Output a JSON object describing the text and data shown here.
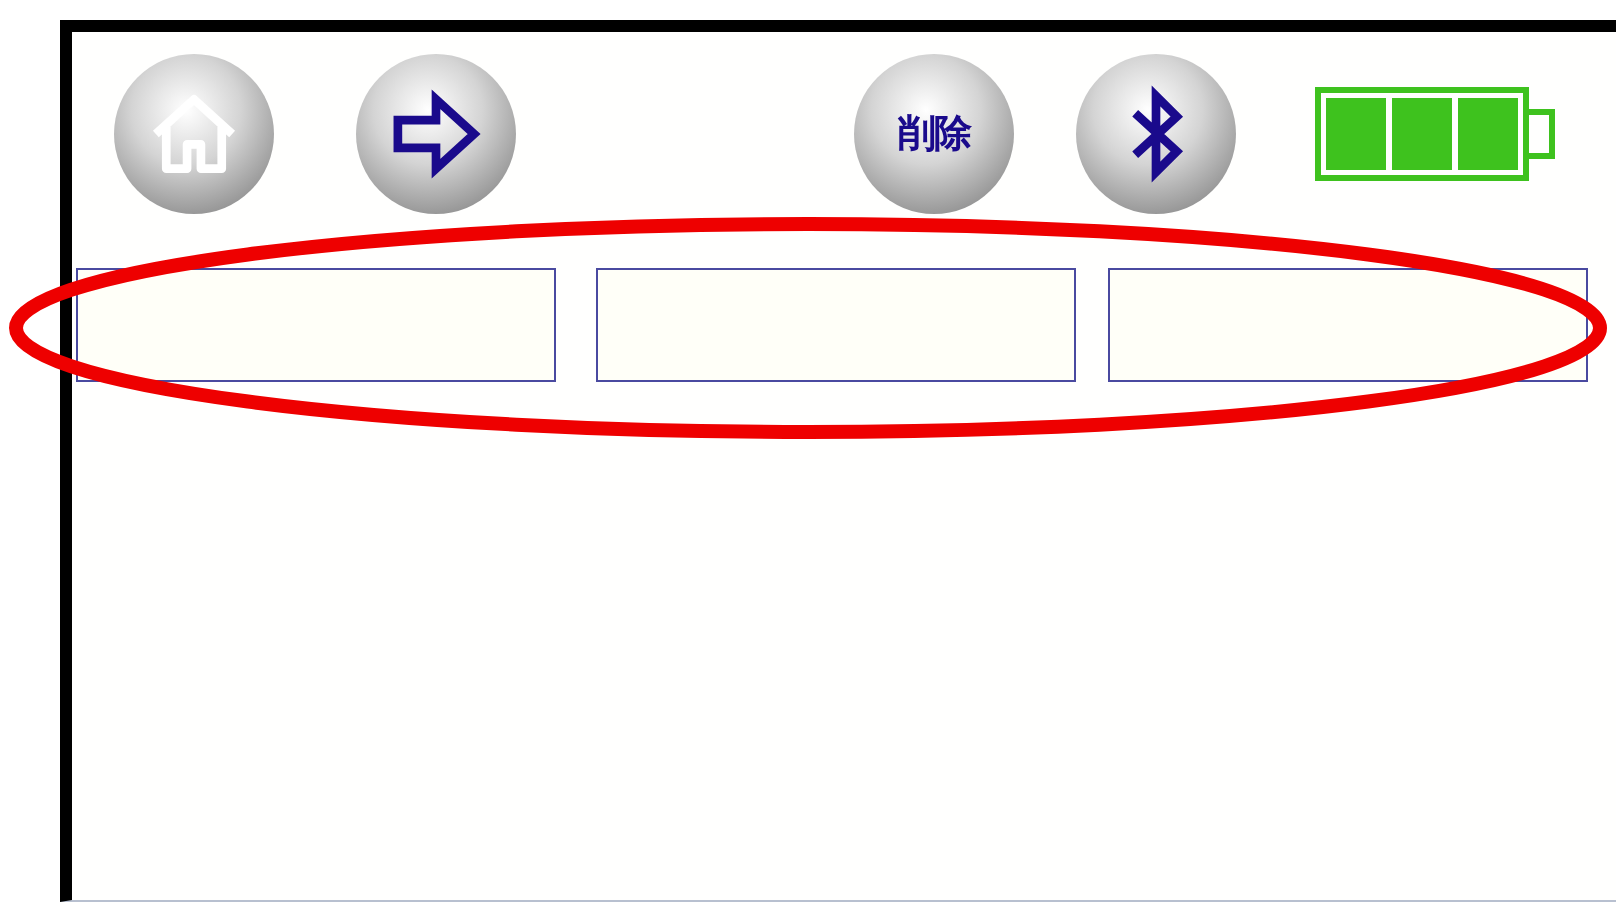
{
  "toolbar": [
    {
      "kind": "home"
    },
    {
      "kind": "forward"
    },
    {
      "kind": "text",
      "label": "削除"
    },
    {
      "kind": "bluetooth"
    }
  ],
  "battery": {
    "kind": "full"
  },
  "fields": [
    {
      "kind": "text"
    },
    {
      "kind": "text"
    },
    {
      "kind": "text"
    }
  ],
  "highlight": {
    "kind": "ellipse"
  }
}
